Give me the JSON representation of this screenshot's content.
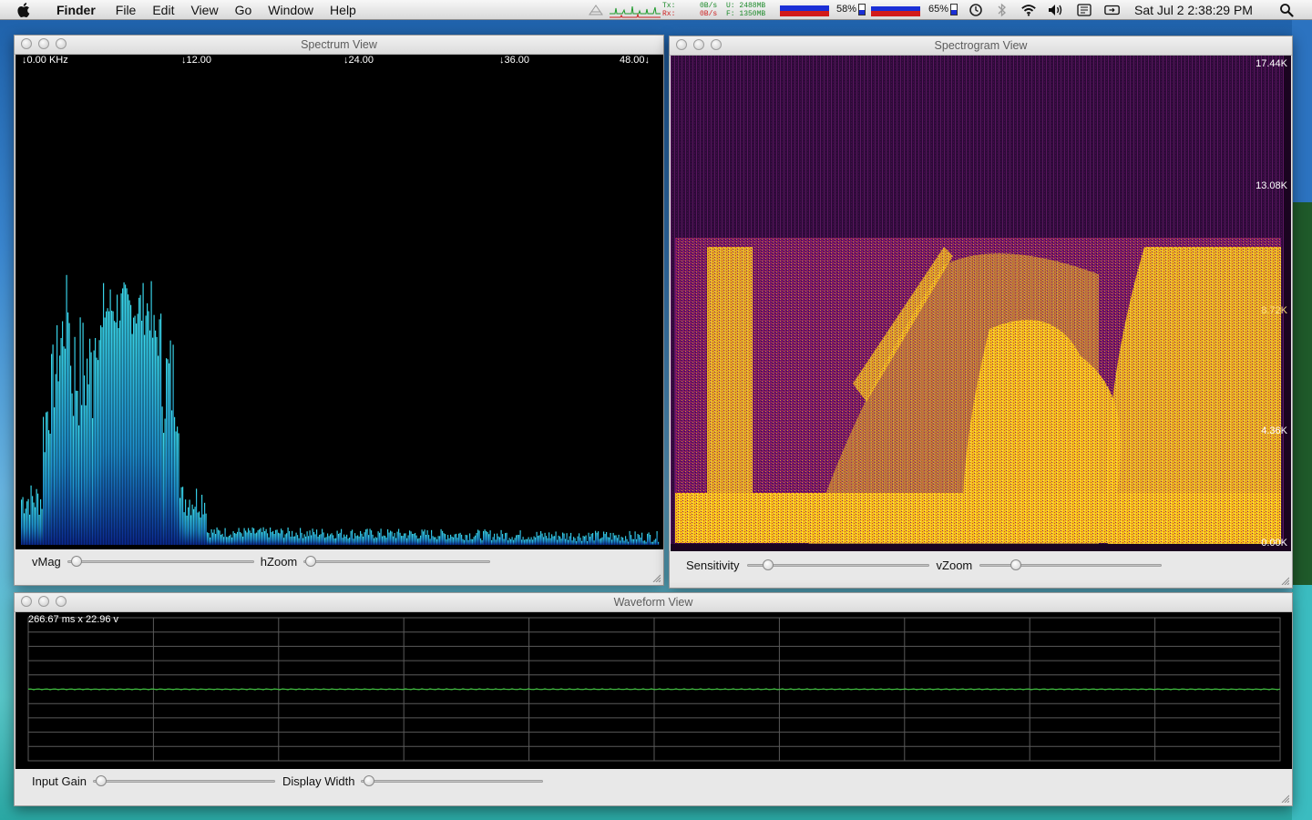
{
  "menubar": {
    "app_name": "Finder",
    "items": [
      "File",
      "Edit",
      "View",
      "Go",
      "Window",
      "Help"
    ],
    "net": {
      "tx_label": "Tx:",
      "rx_label": "Rx:",
      "tx_rate": "0B/s",
      "rx_rate": "0B/s",
      "used": "U: 2488MB",
      "free": "F: 1350MB"
    },
    "cpu_percent": "58%",
    "battery_percent": "65%",
    "clock": "Sat Jul 2  2:38:29 PM",
    "icons": [
      "apple-icon",
      "time-machine-icon",
      "bluetooth-icon",
      "wifi-icon",
      "volume-icon",
      "input-menu-icon",
      "display-icon",
      "spotlight-icon"
    ]
  },
  "spectrum": {
    "title": "Spectrum View",
    "freq_labels": [
      "↓0.00 KHz",
      "↓12.00",
      "↓24.00",
      "↓36.00",
      "48.00↓"
    ],
    "controls": {
      "vmag_label": "vMag",
      "hzoom_label": "hZoom"
    },
    "slider_values": {
      "vmag": 0.05,
      "hzoom": 0.03
    },
    "colors": {
      "bars_light": "#33d2e6",
      "bars_dark": "#0a2d9c"
    }
  },
  "spectrogram": {
    "title": "Spectrogram View",
    "freq_labels": [
      "17.44K",
      "13.08K",
      "8.72K",
      "4.36K",
      "0.00K"
    ],
    "controls": {
      "sensitivity_label": "Sensitivity",
      "vzoom_label": "vZoom"
    },
    "slider_values": {
      "sensitivity": 0.1,
      "vzoom": 0.2
    },
    "colors": {
      "low": "#2a0730",
      "mid": "#9c1a8c",
      "high": "#ffd21a"
    }
  },
  "waveform": {
    "title": "Waveform View",
    "scale_label": "266.67 ms x 22.96 v",
    "controls": {
      "input_gain_label": "Input Gain",
      "display_width_label": "Display Width"
    },
    "slider_values": {
      "input_gain": 0.02,
      "display_width": 0.02
    },
    "colors": {
      "grid": "#5a5a5a",
      "trace": "#3bd23b"
    }
  }
}
